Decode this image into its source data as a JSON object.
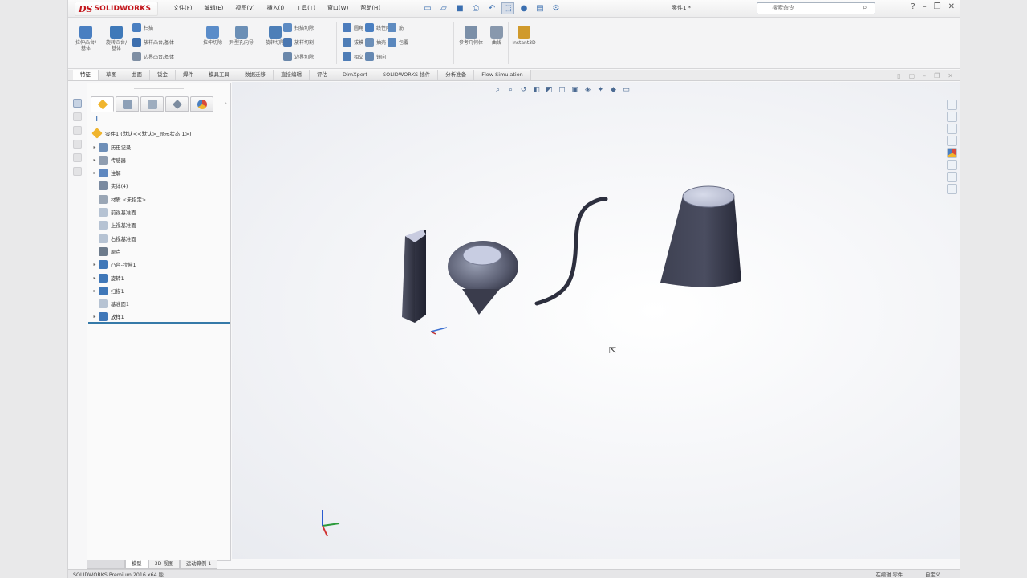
{
  "app": {
    "logo": {
      "ds": "DS",
      "name": "SOLIDWORKS"
    },
    "menu": [
      "文件(F)",
      "编辑(E)",
      "视图(V)",
      "插入(I)",
      "工具(T)",
      "窗口(W)",
      "帮助(H)"
    ],
    "mode_label": "零件1 *",
    "search_placeholder": "搜索命令"
  },
  "cmd": {
    "big": [
      {
        "label": "拉伸凸台/基体",
        "color": "#4a7fc1"
      },
      {
        "label": "旋转凸台/基体",
        "color": "#3f79b9"
      },
      {
        "label": "拉伸切除",
        "color": "#5a8cc9"
      },
      {
        "label": "异型孔向导",
        "color": "#6b8fb6"
      },
      {
        "label": "旋转切除",
        "color": "#4d7fb8"
      }
    ],
    "small": [
      {
        "label": "扫描",
        "color": "#4a7fc1"
      },
      {
        "label": "放样凸台/基体",
        "color": "#3d6fae"
      },
      {
        "label": "边界凸台/基体",
        "color": "#7e8ea3"
      },
      {
        "label": "扫描切除",
        "color": "#5d8bc3"
      },
      {
        "label": "放样切割",
        "color": "#4b77b0"
      },
      {
        "label": "边界切除",
        "color": "#6a87aa"
      },
      {
        "label": "圆角",
        "color": "#4c7cbc"
      },
      {
        "label": "线性阵列",
        "color": "#4a7fc1"
      },
      {
        "label": "筋",
        "color": "#5f8bc0"
      },
      {
        "label": "拔模",
        "color": "#4e7db6"
      },
      {
        "label": "抽壳",
        "color": "#6c8fb8"
      },
      {
        "label": "包覆",
        "color": "#5a87bd"
      },
      {
        "label": "相交",
        "color": "#4d7cb6"
      },
      {
        "label": "镜向",
        "color": "#6588b2"
      }
    ],
    "tail": [
      {
        "label": "参考几何体",
        "color": "#7b8fa8"
      },
      {
        "label": "曲线",
        "color": "#8898ad"
      },
      {
        "label": "Instant3D",
        "color": "#d09a2c"
      }
    ]
  },
  "tabs": [
    "特征",
    "草图",
    "曲面",
    "钣金",
    "焊件",
    "模具工具",
    "数据迁移",
    "直接编辑",
    "评估",
    "DimXpert",
    "SOLIDWORKS 插件",
    "分析准备",
    "Flow Simulation"
  ],
  "feature_tree": {
    "filter_icon": "filter-icon",
    "root": "零件1 (默认<<默认>_显示状态 1>)",
    "nodes": [
      {
        "label": "历史记录",
        "icon": "history-icon",
        "color": "#6e8fb8",
        "exp": "▸"
      },
      {
        "label": "传感器",
        "icon": "sensor-icon",
        "color": "#8f9db0",
        "exp": "▸"
      },
      {
        "label": "注解",
        "icon": "annotation-icon",
        "color": "#5f88c0",
        "exp": "▸"
      },
      {
        "label": "实体(4)",
        "icon": "solid-body-icon",
        "color": "#7a8aa0",
        "exp": ""
      },
      {
        "label": "材质 <未指定>",
        "icon": "material-icon",
        "color": "#9aa6b5",
        "exp": ""
      },
      {
        "label": "前视基准面",
        "icon": "plane-icon",
        "color": "#b6c3d3",
        "exp": ""
      },
      {
        "label": "上视基准面",
        "icon": "plane-icon",
        "color": "#b6c3d3",
        "exp": ""
      },
      {
        "label": "右视基准面",
        "icon": "plane-icon",
        "color": "#b6c3d3",
        "exp": ""
      },
      {
        "label": "原点",
        "icon": "origin-icon",
        "color": "#6d7b8c",
        "exp": ""
      },
      {
        "label": "凸台-拉伸1",
        "icon": "extrude-icon",
        "color": "#3f77b8",
        "exp": "▸"
      },
      {
        "label": "旋转1",
        "icon": "revolve-icon",
        "color": "#3f77b8",
        "exp": "▸"
      },
      {
        "label": "扫描1",
        "icon": "sweep-icon",
        "color": "#3f77b8",
        "exp": "▸"
      },
      {
        "label": "基准面1",
        "icon": "plane-icon",
        "color": "#b6c3d3",
        "exp": ""
      },
      {
        "label": "放样1",
        "icon": "loft-icon",
        "color": "#3f77b8",
        "exp": "▸"
      }
    ]
  },
  "bottom_tabs": [
    "模型",
    "3D 视图",
    "运动算例 1"
  ],
  "status": {
    "left": "SOLIDWORKS Premium 2016 x64 版",
    "right": [
      "在编辑 零件",
      "自定义"
    ]
  }
}
